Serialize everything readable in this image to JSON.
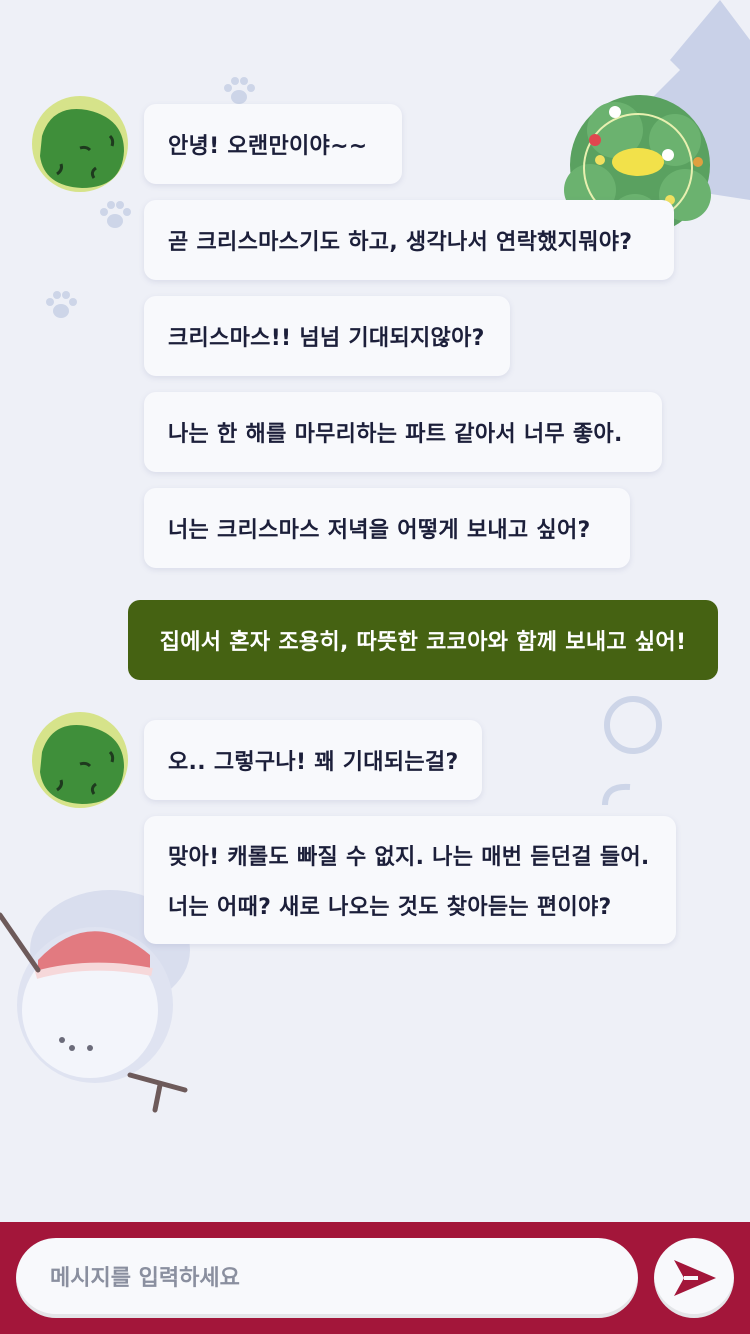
{
  "colors": {
    "background": "#eef0f7",
    "bubble": "#f8f9fc",
    "my_bubble": "#456212",
    "bottom_bar": "#a3163a",
    "placeholder": "#8a8f9f"
  },
  "messages": [
    {
      "sender": "bot",
      "text": "안녕! 오랜만이야~~"
    },
    {
      "sender": "bot",
      "text": "곧 크리스마스기도 하고, 생각나서 연락했지뭐야?"
    },
    {
      "sender": "bot",
      "text": "크리스마스!! 넘넘 기대되지않아?"
    },
    {
      "sender": "bot",
      "text": "나는 한 해를 마무리하는 파트 같아서 너무 좋아."
    },
    {
      "sender": "bot",
      "text": "너는 크리스마스 저녁을 어떻게 보내고 싶어?"
    },
    {
      "sender": "me",
      "text": "집에서 혼자 조용히, 따뜻한 코코아와 함께 보내고 싶어!"
    },
    {
      "sender": "bot",
      "text": "오.. 그렇구나! 꽤 기대되는걸?"
    },
    {
      "sender": "bot",
      "lines": [
        "맞아! 캐롤도 빠질 수 없지. 나는 매번 듣던걸 들어.",
        "너는 어때? 새로 나오는 것도 찾아듣는 편이야?"
      ]
    }
  ],
  "composer": {
    "placeholder": "메시지를 입력하세요",
    "value": ""
  },
  "icons": {
    "send": "send-arrow-icon",
    "avatar": "green-blob-avatar"
  }
}
